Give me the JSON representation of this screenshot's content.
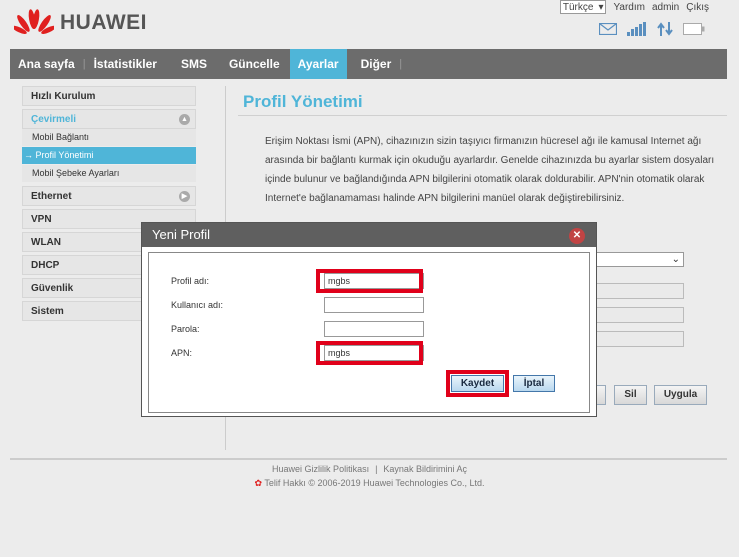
{
  "header": {
    "logo_text": "HUAWEI",
    "language": "Türkçe",
    "links": {
      "help": "Yardım",
      "user": "admin",
      "logout": "Çıkış"
    }
  },
  "nav": {
    "items": [
      {
        "label": "Ana sayfa"
      },
      {
        "label": "İstatistikler"
      },
      {
        "label": "SMS"
      },
      {
        "label": "Güncelle"
      },
      {
        "label": "Ayarlar"
      },
      {
        "label": "Diğer"
      }
    ],
    "active": "Ayarlar"
  },
  "sidebar": {
    "quick_setup": "Hızlı Kurulum",
    "dialup": "Çevirmeli",
    "dialup_sub": [
      "Mobil Bağlantı",
      "→ Profil Yönetimi",
      "Mobil Şebeke Ayarları"
    ],
    "ethernet": "Ethernet",
    "vpn": "VPN",
    "wlan": "WLAN",
    "dhcp": "DHCP",
    "security": "Güvenlik",
    "system": "Sistem"
  },
  "main": {
    "title": "Profil Yönetimi",
    "description": "Erişim Noktası İsmi (APN), cihazınızın sizin taşıyıcı firmanızın hücresel ağı ile kamusal Internet ağı arasında bir bağlantı kurmak için okuduğu ayarlardır. Genelde cihazınızda bu ayarlar sistem dosyaları içinde bulunur ve bağlandığında APN bilgilerini otomatik olarak doldurabilir. APN'nin otomatik olarak Internet'e bağlanamaması halinde APN bilgilerini manüel olarak değiştirebilirsiniz.",
    "delete_button": "Sil",
    "apply_button": "Uygula"
  },
  "dialog": {
    "title": "Yeni Profil",
    "fields": {
      "profile_name": {
        "label": "Profil adı:",
        "value": "mgbs"
      },
      "username": {
        "label": "Kullanıcı adı:",
        "value": ""
      },
      "password": {
        "label": "Parola:",
        "value": ""
      },
      "apn": {
        "label": "APN:",
        "value": "mgbs"
      }
    },
    "save_button": "Kaydet",
    "cancel_button": "İptal"
  },
  "footer": {
    "privacy": "Huawei Gizlilik Politikası",
    "source": "Kaynak Bildirimini Aç",
    "copyright": "Telif Hakkı © 2006-2019 Huawei Technologies Co., Ltd."
  },
  "colors": {
    "accent": "#4fb5d8",
    "nav_bg": "#6c6c6c",
    "highlight": "#e0001a",
    "brand_red": "#e0201f"
  },
  "icons": [
    "huawei-logo",
    "sms-envelope-icon",
    "signal-strength-icon",
    "data-transfer-icon",
    "battery-icon",
    "close-icon"
  ]
}
